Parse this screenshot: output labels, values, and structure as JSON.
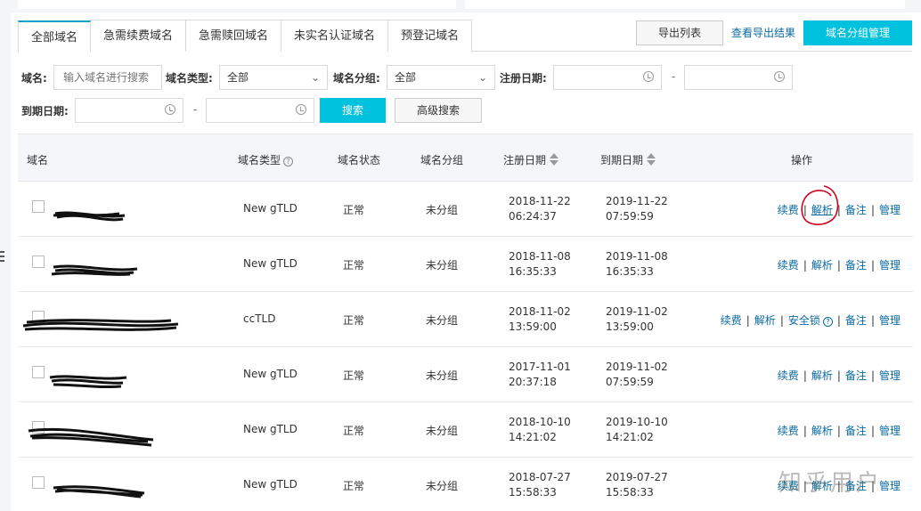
{
  "tabs": [
    "全部域名",
    "急需续费域名",
    "急需赎回域名",
    "未实名认证域名",
    "预登记域名"
  ],
  "toolbar": {
    "export_list": "导出列表",
    "view_export": "查看导出结果",
    "group_manage": "域名分组管理"
  },
  "filters": {
    "domain_label": "域名:",
    "domain_placeholder": "输入域名进行搜索",
    "type_label": "域名类型:",
    "type_value": "全部",
    "group_label": "域名分组:",
    "group_value": "全部",
    "reg_date_label": "注册日期:",
    "expire_date_label": "到期日期:",
    "dash": "-",
    "search": "搜索",
    "advanced": "高级搜索"
  },
  "columns": {
    "domain": "域名",
    "type": "域名类型",
    "status": "域名状态",
    "group": "域名分组",
    "reg_date": "注册日期",
    "expire_date": "到期日期",
    "actions": "操作"
  },
  "rows": [
    {
      "type": "New gTLD",
      "status": "正常",
      "group": "未分组",
      "reg_date": "2018-11-22",
      "reg_time": "06:24:37",
      "exp_date": "2019-11-22",
      "exp_time": "07:59:59",
      "ops": [
        "续费",
        "解析",
        "备注",
        "管理"
      ]
    },
    {
      "type": "New gTLD",
      "status": "正常",
      "group": "未分组",
      "reg_date": "2018-11-08",
      "reg_time": "16:35:33",
      "exp_date": "2019-11-08",
      "exp_time": "16:35:33",
      "ops": [
        "续费",
        "解析",
        "备注",
        "管理"
      ]
    },
    {
      "type": "ccTLD",
      "status": "正常",
      "group": "未分组",
      "reg_date": "2018-11-02",
      "reg_time": "13:59:00",
      "exp_date": "2019-11-02",
      "exp_time": "13:59:00",
      "ops": [
        "续费",
        "解析",
        "安全锁",
        "备注",
        "管理"
      ]
    },
    {
      "type": "New gTLD",
      "status": "正常",
      "group": "未分组",
      "reg_date": "2017-11-01",
      "reg_time": "20:37:18",
      "exp_date": "2019-11-02",
      "exp_time": "07:59:59",
      "ops": [
        "续费",
        "解析",
        "备注",
        "管理"
      ]
    },
    {
      "type": "New gTLD",
      "status": "正常",
      "group": "未分组",
      "reg_date": "2018-10-10",
      "reg_time": "14:21:02",
      "exp_date": "2019-10-10",
      "exp_time": "14:21:02",
      "ops": [
        "续费",
        "解析",
        "备注",
        "管理"
      ]
    },
    {
      "type": "New gTLD",
      "status": "正常",
      "group": "未分组",
      "reg_date": "2018-07-27",
      "reg_time": "15:58:33",
      "exp_date": "2019-07-27",
      "exp_time": "15:58:33",
      "ops": [
        "续费",
        "解析",
        "备注",
        "管理"
      ]
    }
  ],
  "watermark": "知乎用户",
  "colors": {
    "accent": "#00c1de",
    "link": "#0a6aa1",
    "annotation": "#d0021b"
  }
}
